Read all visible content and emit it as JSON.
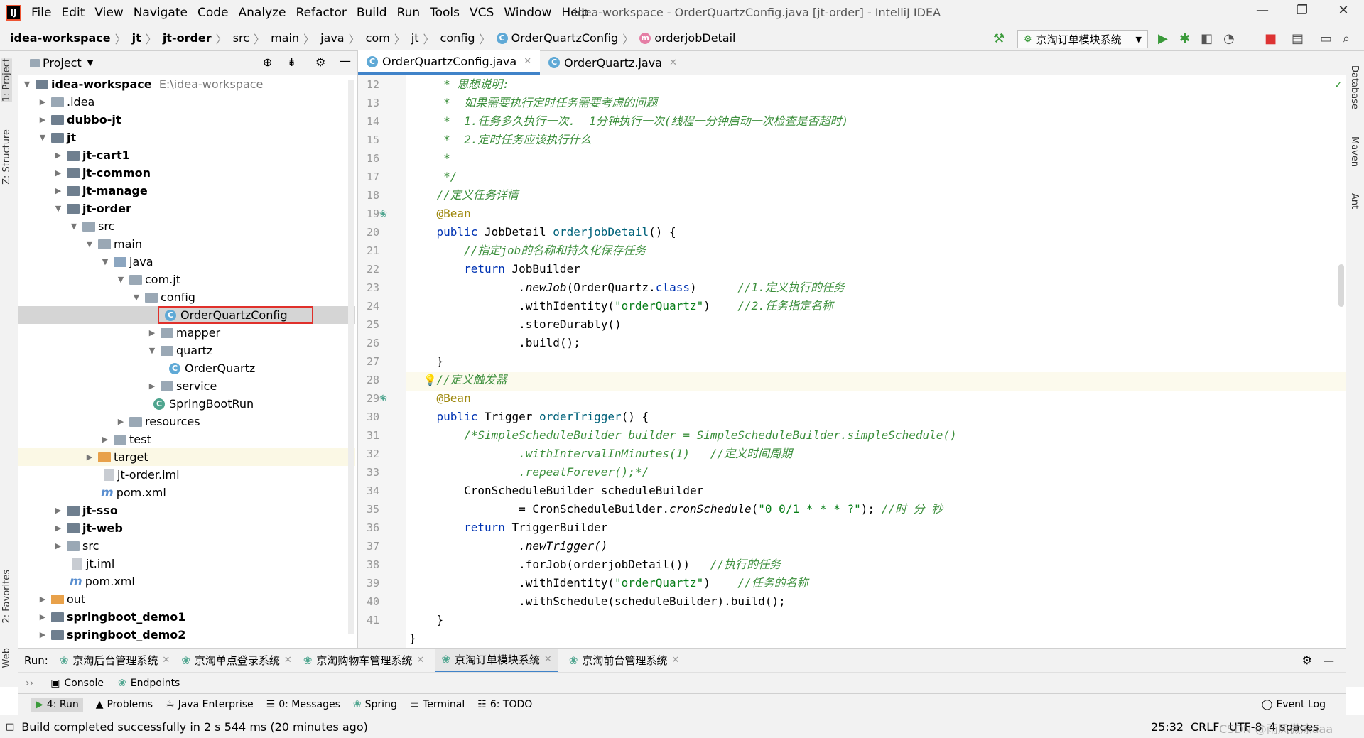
{
  "window": {
    "title": "idea-workspace - OrderQuartzConfig.java [jt-order] - IntelliJ IDEA"
  },
  "menu": [
    "File",
    "Edit",
    "View",
    "Navigate",
    "Code",
    "Analyze",
    "Refactor",
    "Build",
    "Run",
    "Tools",
    "VCS",
    "Window",
    "Help"
  ],
  "breadcrumb": [
    "idea-workspace",
    "jt",
    "jt-order",
    "src",
    "main",
    "java",
    "com",
    "jt",
    "config",
    "OrderQuartzConfig",
    "orderjobDetail"
  ],
  "run_config": "京淘订单模块系统",
  "left_tabs": {
    "project": "1: Project",
    "structure": "Z: Structure",
    "favorites": "2: Favorites",
    "web": "Web"
  },
  "right_tabs": {
    "database": "Database",
    "maven": "Maven",
    "ant": "Ant"
  },
  "project_panel": {
    "title": "Project"
  },
  "tree": [
    {
      "label": "idea-workspace",
      "extra": "E:\\idea-workspace",
      "bold": true
    },
    {
      "label": ".idea"
    },
    {
      "label": "dubbo-jt",
      "bold": true
    },
    {
      "label": "jt",
      "bold": true
    },
    {
      "label": "jt-cart1",
      "bold": true
    },
    {
      "label": "jt-common",
      "bold": true
    },
    {
      "label": "jt-manage",
      "bold": true
    },
    {
      "label": "jt-order",
      "bold": true
    },
    {
      "label": "src"
    },
    {
      "label": "main"
    },
    {
      "label": "java"
    },
    {
      "label": "com.jt"
    },
    {
      "label": "config"
    },
    {
      "label": "OrderQuartzConfig"
    },
    {
      "label": "mapper"
    },
    {
      "label": "quartz"
    },
    {
      "label": "OrderQuartz"
    },
    {
      "label": "service"
    },
    {
      "label": "SpringBootRun"
    },
    {
      "label": "resources"
    },
    {
      "label": "test"
    },
    {
      "label": "target"
    },
    {
      "label": "jt-order.iml"
    },
    {
      "label": "pom.xml"
    },
    {
      "label": "jt-sso",
      "bold": true
    },
    {
      "label": "jt-web",
      "bold": true
    },
    {
      "label": "src"
    },
    {
      "label": "jt.iml"
    },
    {
      "label": "pom.xml"
    },
    {
      "label": "out"
    },
    {
      "label": "springboot_demo1",
      "bold": true
    },
    {
      "label": "springboot_demo2",
      "bold": true
    }
  ],
  "editor_tabs": [
    {
      "label": "OrderQuartzConfig.java"
    },
    {
      "label": "OrderQuartz.java"
    }
  ],
  "code": {
    "line_numbers": [
      "12",
      "13",
      "14",
      "15",
      "16",
      "17",
      "18",
      "19",
      "20",
      "21",
      "22",
      "23",
      "24",
      "25",
      "26",
      "27",
      "28",
      "29",
      "30",
      "31",
      "32",
      "33",
      "34",
      "35",
      "36",
      "37",
      "38",
      "39",
      "40",
      "41"
    ],
    "lines": {
      "l12": "     * 思想说明:",
      "l13": "     *  如果需要执行定时任务需要考虑的问题",
      "l14": "     *  1.任务多久执行一次.  1分钟执行一次(线程一分钟启动一次检查是否超时)",
      "l15": "     *  2.定时任务应该执行什么",
      "l16": "     *",
      "l17": "     */",
      "l18": "    //定义任务详情",
      "l19": "    @Bean",
      "l20a": "    public ",
      "l20b": "JobDetail ",
      "l20c": "orderjobDetail",
      "l20d": "() {",
      "l21": "        //指定job的名称和持久化保存任务",
      "l22a": "        return ",
      "l22b": "JobBuilder",
      "l23a": "                .newJob",
      "l23b": "(OrderQuartz.",
      "l23c": "class",
      "l23d": ")      ",
      "l23e": "//1.定义执行的任务",
      "l24a": "                .withIdentity(",
      "l24b": "\"orderQuartz\"",
      "l24c": ")    ",
      "l24d": "//2.任务指定名称",
      "l25": "                .storeDurably()",
      "l26": "                .build();",
      "l27": "    }",
      "l28": "    //定义触发器",
      "l29": "    @Bean",
      "l30a": "    public ",
      "l30b": "Trigger ",
      "l30c": "orderTrigger",
      "l30d": "() {",
      "l31": "        /*SimpleScheduleBuilder builder = SimpleScheduleBuilder.simpleSchedule()",
      "l32": "                .withIntervalInMinutes(1)   //定义时间周期",
      "l33": "                .repeatForever();*/",
      "l34": "        CronScheduleBuilder scheduleBuilder",
      "l35a": "                = CronScheduleBuilder.",
      "l35b": "cronSchedule",
      "l35c": "(",
      "l35d": "\"0 0/1 * * * ?\"",
      "l35e": "); ",
      "l35f": "//时 分 秒",
      "l36a": "        return ",
      "l36b": "TriggerBuilder",
      "l37": "                .newTrigger()",
      "l38a": "                .forJob(orderjobDetail())   ",
      "l38b": "//执行的任务",
      "l39a": "                .withIdentity(",
      "l39b": "\"orderQuartz\"",
      "l39c": ")    ",
      "l39d": "//任务的名称",
      "l40": "                .withSchedule(scheduleBuilder).build();",
      "l41": "    }",
      "l42": "}"
    }
  },
  "run_panel": {
    "label": "Run:",
    "tabs": [
      "京淘后台管理系统",
      "京淘单点登录系统",
      "京淘购物车管理系统",
      "京淘订单模块系统",
      "京淘前台管理系统"
    ],
    "sub_tabs": [
      "Console",
      "Endpoints"
    ]
  },
  "tool_tabs": [
    "4: Run",
    "Problems",
    "Java Enterprise",
    "0: Messages",
    "Spring",
    "Terminal",
    "6: TODO"
  ],
  "event_log": "Event Log",
  "status": {
    "message": "Build completed successfully in 2 s 544 ms (20 minutes ago)",
    "position": "25:32",
    "line_sep": "CRLF",
    "encoding": "UTF-8",
    "indent": "4 spaces",
    "watermark": "CSDN @雨风微凉aaa"
  },
  "colors": {
    "accent": "#4083c9",
    "selection_box": "#e0302b"
  }
}
